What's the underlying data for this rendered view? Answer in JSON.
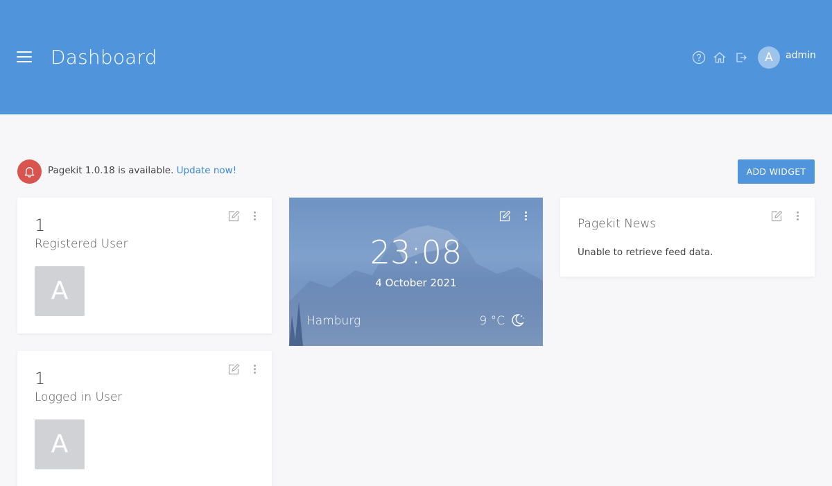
{
  "header": {
    "title": "Dashboard",
    "username": "admin",
    "avatar_letter": "A",
    "icons": [
      "menu-icon",
      "help-icon",
      "home-icon",
      "logout-icon"
    ]
  },
  "notice": {
    "text": "Pagekit 1.0.18 is available.",
    "link": "Update now!",
    "icon": "bell-icon",
    "color": "#d9534f"
  },
  "toolbar": {
    "add_widget_label": "ADD WIDGET"
  },
  "widgets": {
    "registered": {
      "count": "1",
      "label": "Registered User",
      "avatar_letter": "A"
    },
    "logged_in": {
      "count": "1",
      "label": "Logged in User",
      "avatar_letter": "A"
    },
    "weather": {
      "time": "23:08",
      "date": "4 October 2021",
      "city": "Hamburg",
      "temp": "9 °C",
      "icon": "moon-icon"
    },
    "news": {
      "title": "Pagekit News",
      "message": "Unable to retrieve feed data."
    }
  },
  "colors": {
    "primary": "#5094dc",
    "background": "#f7f7f9",
    "alert": "#d9534f",
    "link": "#3a87d0"
  }
}
